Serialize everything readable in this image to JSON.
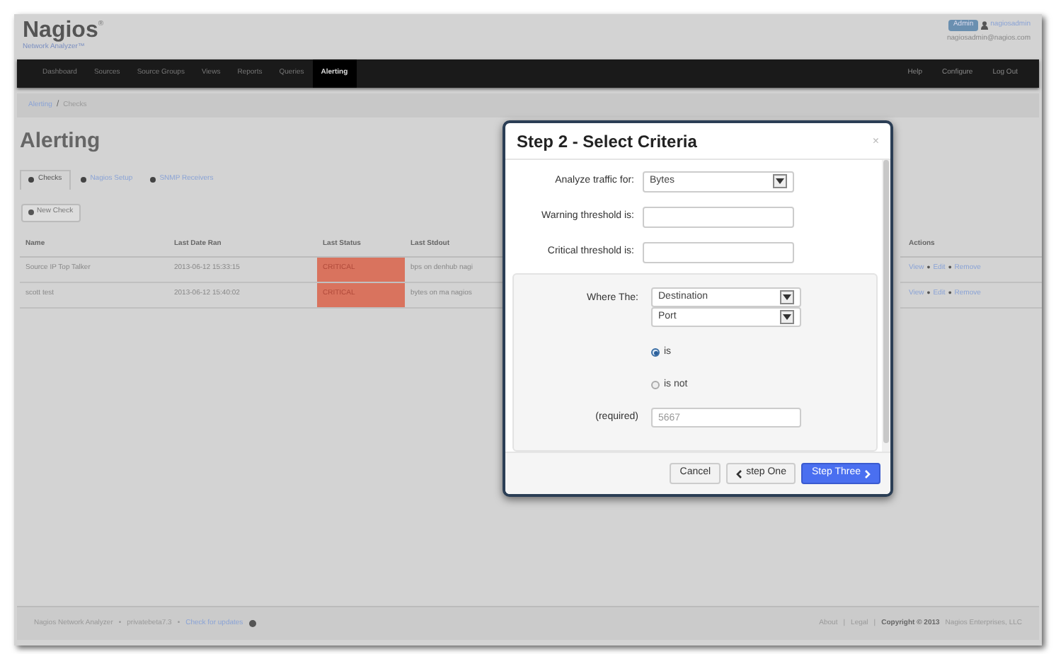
{
  "header": {
    "logo": "Nagios",
    "logo_mark": "®",
    "subtitle": "Network Analyzer™",
    "badge": "Admin",
    "username": "nagiosadmin",
    "email": "nagiosadmin@nagios.com"
  },
  "nav": {
    "items": [
      {
        "label": "Dashboard",
        "selected": false
      },
      {
        "label": "Sources",
        "selected": false
      },
      {
        "label": "Source Groups",
        "selected": false
      },
      {
        "label": "Views",
        "selected": false
      },
      {
        "label": "Reports",
        "selected": false
      },
      {
        "label": "Queries",
        "selected": false
      },
      {
        "label": "Alerting",
        "selected": true
      }
    ],
    "right": [
      "Help",
      "Configure",
      "Log Out"
    ]
  },
  "breadcrumb": {
    "items": [
      "Alerting",
      "Checks"
    ],
    "separator": "/"
  },
  "page_title": "Alerting",
  "tabs": [
    {
      "label": "Checks",
      "selected": true
    },
    {
      "label": "Nagios Setup",
      "selected": false
    },
    {
      "label": "SNMP Receivers",
      "selected": false
    }
  ],
  "new_button": "New Check",
  "table": {
    "columns": [
      "Name",
      "Last Date Ran",
      "Last Status",
      "Last Stdout",
      "Actions"
    ],
    "rows": [
      {
        "name": "Source IP Top Talker",
        "date": "2013-06-12 15:33:15",
        "status": "CRITICAL",
        "critical": true,
        "stdout": "bps on denhub nagi",
        "actions": [
          "View",
          "Edit",
          "Remove"
        ]
      },
      {
        "name": "scott test",
        "date": "2013-06-12 15:40:02",
        "status": "CRITICAL",
        "critical": true,
        "stdout": "bytes on ma nagios",
        "actions": [
          "View",
          "Edit",
          "Remove"
        ]
      }
    ],
    "action_separator": "•"
  },
  "modal": {
    "title": "Step 2 - Select Criteria",
    "close": "×",
    "fields": [
      {
        "label": "Analyze traffic for:",
        "kind": "select",
        "value": "Bytes"
      },
      {
        "label": "Warning threshold is:",
        "kind": "input"
      },
      {
        "label": "Critical threshold is:",
        "kind": "input"
      }
    ],
    "where": {
      "label": "Where The:",
      "selects": [
        "Destination",
        "Port"
      ],
      "radios": [
        {
          "label": "is",
          "selected": true
        },
        {
          "label": "is not",
          "selected": false
        }
      ],
      "required_label": "(required)",
      "required_placeholder": "5667"
    },
    "buttons": [
      {
        "label": "Cancel",
        "kind": "plain"
      },
      {
        "label": "step One",
        "kind": "back"
      },
      {
        "label": "Step Three",
        "kind": "next"
      }
    ]
  },
  "footer": {
    "left": [
      {
        "text": "Nagios Network Analyzer",
        "kind": "text"
      },
      {
        "text": "•",
        "kind": "sep"
      },
      {
        "text": "privatebeta7.3",
        "kind": "text"
      },
      {
        "text": "•",
        "kind": "sep"
      },
      {
        "text": "Check for updates",
        "kind": "link"
      }
    ],
    "right": [
      {
        "text": "About",
        "kind": "text"
      },
      {
        "text": "|",
        "kind": "sep"
      },
      {
        "text": "Legal",
        "kind": "text"
      },
      {
        "text": "|",
        "kind": "sep"
      },
      {
        "text": "Copyright © 2013",
        "kind": "bold"
      },
      {
        "text": "Nagios Enterprises, LLC",
        "kind": "text"
      }
    ]
  }
}
